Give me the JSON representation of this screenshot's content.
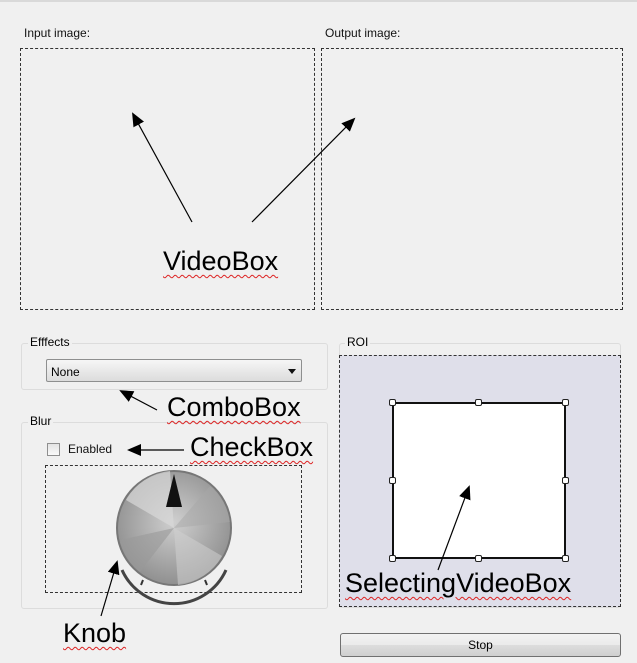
{
  "input": {
    "label": "Input image:"
  },
  "output": {
    "label": "Output image:"
  },
  "effects": {
    "title": "Efffects",
    "selected": "None"
  },
  "blur": {
    "title": "Blur",
    "checkbox_label": "Enabled",
    "checkbox_checked": false
  },
  "roi": {
    "title": "ROI"
  },
  "stop_button": {
    "label": "Stop"
  },
  "annotations": {
    "videobox": "VideoBox",
    "combobox": "ComboBox",
    "checkbox": "CheckBox",
    "knob": "Knob",
    "selecting_videobox": "SelectingVideoBox"
  },
  "icons": [
    "dropdown-arrow-icon",
    "knob-pointer-icon",
    "annotation-arrow-icon"
  ]
}
